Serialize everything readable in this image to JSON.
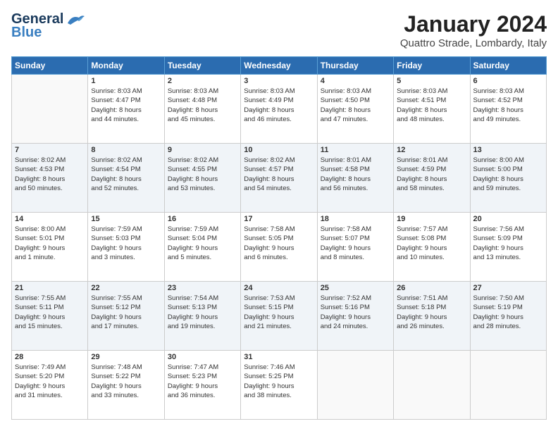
{
  "logo": {
    "text_general": "General",
    "text_blue": "Blue"
  },
  "header": {
    "title": "January 2024",
    "subtitle": "Quattro Strade, Lombardy, Italy"
  },
  "days_of_week": [
    "Sunday",
    "Monday",
    "Tuesday",
    "Wednesday",
    "Thursday",
    "Friday",
    "Saturday"
  ],
  "weeks": [
    [
      {
        "day": "",
        "info": ""
      },
      {
        "day": "1",
        "info": "Sunrise: 8:03 AM\nSunset: 4:47 PM\nDaylight: 8 hours\nand 44 minutes."
      },
      {
        "day": "2",
        "info": "Sunrise: 8:03 AM\nSunset: 4:48 PM\nDaylight: 8 hours\nand 45 minutes."
      },
      {
        "day": "3",
        "info": "Sunrise: 8:03 AM\nSunset: 4:49 PM\nDaylight: 8 hours\nand 46 minutes."
      },
      {
        "day": "4",
        "info": "Sunrise: 8:03 AM\nSunset: 4:50 PM\nDaylight: 8 hours\nand 47 minutes."
      },
      {
        "day": "5",
        "info": "Sunrise: 8:03 AM\nSunset: 4:51 PM\nDaylight: 8 hours\nand 48 minutes."
      },
      {
        "day": "6",
        "info": "Sunrise: 8:03 AM\nSunset: 4:52 PM\nDaylight: 8 hours\nand 49 minutes."
      }
    ],
    [
      {
        "day": "7",
        "info": "Sunrise: 8:02 AM\nSunset: 4:53 PM\nDaylight: 8 hours\nand 50 minutes."
      },
      {
        "day": "8",
        "info": "Sunrise: 8:02 AM\nSunset: 4:54 PM\nDaylight: 8 hours\nand 52 minutes."
      },
      {
        "day": "9",
        "info": "Sunrise: 8:02 AM\nSunset: 4:55 PM\nDaylight: 8 hours\nand 53 minutes."
      },
      {
        "day": "10",
        "info": "Sunrise: 8:02 AM\nSunset: 4:57 PM\nDaylight: 8 hours\nand 54 minutes."
      },
      {
        "day": "11",
        "info": "Sunrise: 8:01 AM\nSunset: 4:58 PM\nDaylight: 8 hours\nand 56 minutes."
      },
      {
        "day": "12",
        "info": "Sunrise: 8:01 AM\nSunset: 4:59 PM\nDaylight: 8 hours\nand 58 minutes."
      },
      {
        "day": "13",
        "info": "Sunrise: 8:00 AM\nSunset: 5:00 PM\nDaylight: 8 hours\nand 59 minutes."
      }
    ],
    [
      {
        "day": "14",
        "info": "Sunrise: 8:00 AM\nSunset: 5:01 PM\nDaylight: 9 hours\nand 1 minute."
      },
      {
        "day": "15",
        "info": "Sunrise: 7:59 AM\nSunset: 5:03 PM\nDaylight: 9 hours\nand 3 minutes."
      },
      {
        "day": "16",
        "info": "Sunrise: 7:59 AM\nSunset: 5:04 PM\nDaylight: 9 hours\nand 5 minutes."
      },
      {
        "day": "17",
        "info": "Sunrise: 7:58 AM\nSunset: 5:05 PM\nDaylight: 9 hours\nand 6 minutes."
      },
      {
        "day": "18",
        "info": "Sunrise: 7:58 AM\nSunset: 5:07 PM\nDaylight: 9 hours\nand 8 minutes."
      },
      {
        "day": "19",
        "info": "Sunrise: 7:57 AM\nSunset: 5:08 PM\nDaylight: 9 hours\nand 10 minutes."
      },
      {
        "day": "20",
        "info": "Sunrise: 7:56 AM\nSunset: 5:09 PM\nDaylight: 9 hours\nand 13 minutes."
      }
    ],
    [
      {
        "day": "21",
        "info": "Sunrise: 7:55 AM\nSunset: 5:11 PM\nDaylight: 9 hours\nand 15 minutes."
      },
      {
        "day": "22",
        "info": "Sunrise: 7:55 AM\nSunset: 5:12 PM\nDaylight: 9 hours\nand 17 minutes."
      },
      {
        "day": "23",
        "info": "Sunrise: 7:54 AM\nSunset: 5:13 PM\nDaylight: 9 hours\nand 19 minutes."
      },
      {
        "day": "24",
        "info": "Sunrise: 7:53 AM\nSunset: 5:15 PM\nDaylight: 9 hours\nand 21 minutes."
      },
      {
        "day": "25",
        "info": "Sunrise: 7:52 AM\nSunset: 5:16 PM\nDaylight: 9 hours\nand 24 minutes."
      },
      {
        "day": "26",
        "info": "Sunrise: 7:51 AM\nSunset: 5:18 PM\nDaylight: 9 hours\nand 26 minutes."
      },
      {
        "day": "27",
        "info": "Sunrise: 7:50 AM\nSunset: 5:19 PM\nDaylight: 9 hours\nand 28 minutes."
      }
    ],
    [
      {
        "day": "28",
        "info": "Sunrise: 7:49 AM\nSunset: 5:20 PM\nDaylight: 9 hours\nand 31 minutes."
      },
      {
        "day": "29",
        "info": "Sunrise: 7:48 AM\nSunset: 5:22 PM\nDaylight: 9 hours\nand 33 minutes."
      },
      {
        "day": "30",
        "info": "Sunrise: 7:47 AM\nSunset: 5:23 PM\nDaylight: 9 hours\nand 36 minutes."
      },
      {
        "day": "31",
        "info": "Sunrise: 7:46 AM\nSunset: 5:25 PM\nDaylight: 9 hours\nand 38 minutes."
      },
      {
        "day": "",
        "info": ""
      },
      {
        "day": "",
        "info": ""
      },
      {
        "day": "",
        "info": ""
      }
    ]
  ]
}
